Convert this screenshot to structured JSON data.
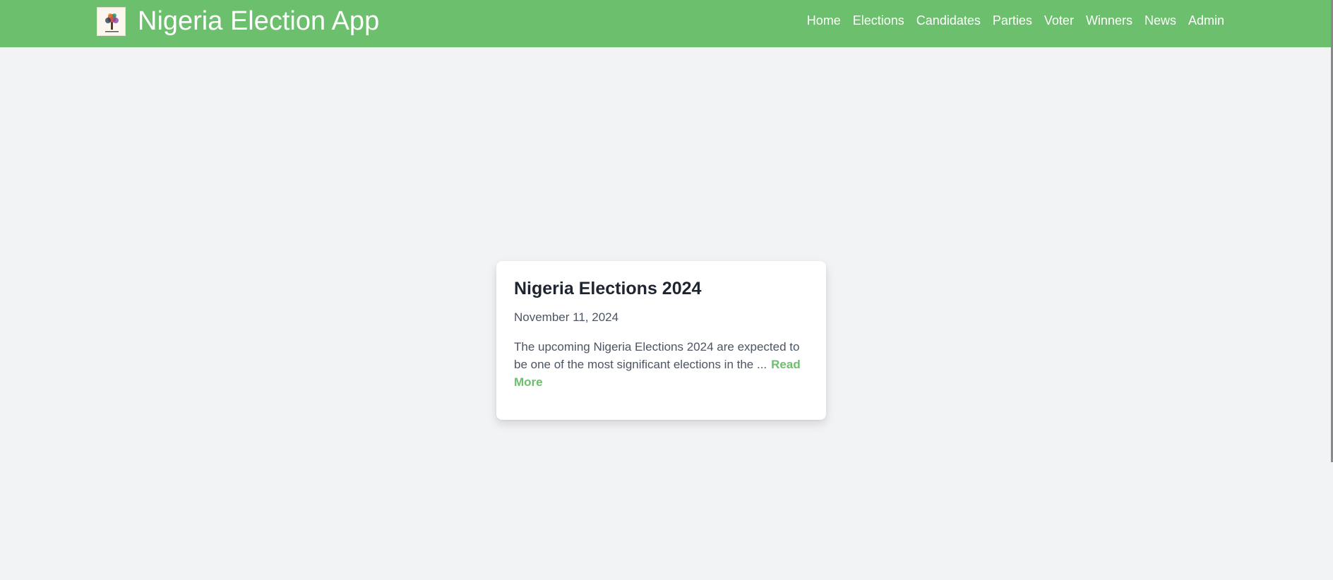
{
  "header": {
    "title": "Nigeria Election App",
    "logo_icon": "tree-logo-icon",
    "background_color": "#6cbf6c"
  },
  "nav": {
    "items": [
      {
        "label": "Home"
      },
      {
        "label": "Elections"
      },
      {
        "label": "Candidates"
      },
      {
        "label": "Parties"
      },
      {
        "label": "Voter"
      },
      {
        "label": "Winners"
      },
      {
        "label": "News"
      },
      {
        "label": "Admin"
      }
    ]
  },
  "news_card": {
    "title": "Nigeria Elections 2024",
    "date": "November 11, 2024",
    "excerpt": "The upcoming Nigeria Elections 2024 are expected to be one of the most significant elections in the ...",
    "read_more_label": "Read More",
    "accent_color": "#6cbf6c"
  },
  "page": {
    "background_color": "#f2f3f5"
  }
}
